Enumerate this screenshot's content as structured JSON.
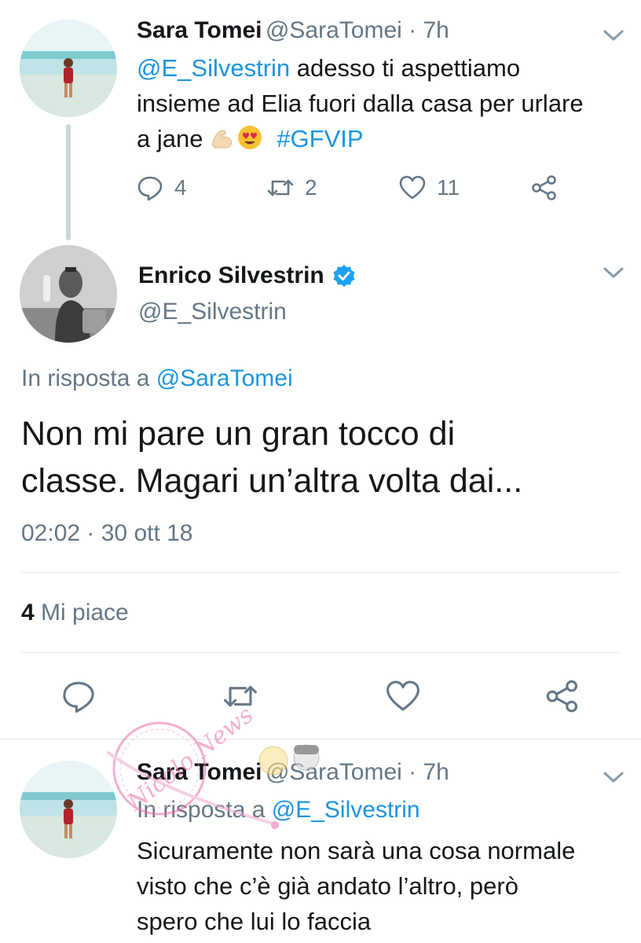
{
  "tweet1": {
    "display_name": "Sara Tomei",
    "handle_time": "@SaraTomei · 7h",
    "mention": "@E_Silvestrin",
    "text_line1": " adesso ti aspettiamo",
    "text_line2": "insieme ad Elia fuori dalla casa per urlare",
    "text_line3": "a jane ",
    "hashtag": "#GFVIP",
    "emoji": [
      "flexed-biceps-emoji",
      "heart-eyes-emoji"
    ],
    "replies": "4",
    "retweets": "2",
    "likes": "11"
  },
  "tweet2": {
    "display_name": "Enrico Silvestrin",
    "handle": "@E_Silvestrin",
    "in_reply_prefix": "In risposta a ",
    "in_reply_handle": "@SaraTomei",
    "text_line1": "Non mi pare un gran tocco di",
    "text_line2": "classe. Magari un’altra volta dai...",
    "timestamp": "02:02 · 30 ott 18",
    "likes_count": "4",
    "likes_label": " Mi piace"
  },
  "tweet3": {
    "display_name": "Sara Tomei",
    "handle_time": "@SaraTomei · 7h",
    "in_reply_prefix": "In risposta a ",
    "in_reply_handle": "@E_Silvestrin",
    "text_line1": "Sicuramente non sarà una cosa normale",
    "text_line2": "visto che c’è già andato l’altro, però",
    "text_line3": "spero che lui lo faccia"
  },
  "watermark": {
    "text": "Nicolo News"
  },
  "colors": {
    "link": "#1b95e0",
    "secondary": "#657786",
    "verified": "#1da1f2",
    "divider": "#e1e8ed"
  }
}
